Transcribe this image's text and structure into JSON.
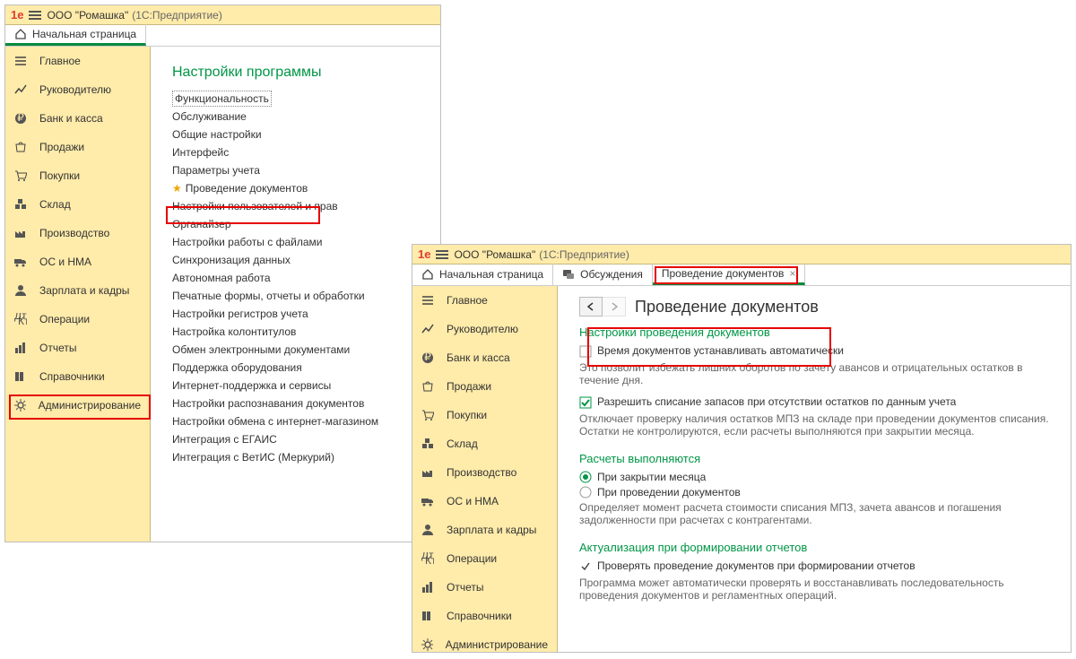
{
  "win1": {
    "title_org": "ООО \"Ромашка\"",
    "title_app": "(1С:Предприятие)",
    "tab_home": "Начальная страница",
    "sidebar": {
      "items": [
        {
          "label": "Главное"
        },
        {
          "label": "Руководителю"
        },
        {
          "label": "Банк и касса"
        },
        {
          "label": "Продажи"
        },
        {
          "label": "Покупки"
        },
        {
          "label": "Склад"
        },
        {
          "label": "Производство"
        },
        {
          "label": "ОС и НМА"
        },
        {
          "label": "Зарплата и кадры"
        },
        {
          "label": "Операции"
        },
        {
          "label": "Отчеты"
        },
        {
          "label": "Справочники"
        },
        {
          "label": "Администрирование"
        }
      ]
    },
    "content": {
      "heading": "Настройки программы",
      "links": [
        "Функциональность",
        "Обслуживание",
        "Общие настройки",
        "Интерфейс",
        "Параметры учета",
        "Проведение документов",
        "Настройки пользователей и прав",
        "Органайзер",
        "Настройки работы с файлами",
        "Синхронизация данных",
        "Автономная работа",
        "Печатные формы, отчеты и обработки",
        "Настройки регистров учета",
        "Настройка колонтитулов",
        "Обмен электронными документами",
        "Поддержка оборудования",
        "Интернет-поддержка и сервисы",
        "Настройки распознавания документов",
        "Настройки обмена с интернет-магазином",
        "Интеграция с ЕГАИС",
        "Интеграция с ВетИС (Меркурий)"
      ]
    }
  },
  "win2": {
    "title_org": "ООО \"Ромашка\"",
    "title_app": "(1С:Предприятие)",
    "tabs": {
      "home": "Начальная страница",
      "discuss": "Обсуждения",
      "docposting": "Проведение документов"
    },
    "sidebar": {
      "items": [
        {
          "label": "Главное"
        },
        {
          "label": "Руководителю"
        },
        {
          "label": "Банк и касса"
        },
        {
          "label": "Продажи"
        },
        {
          "label": "Покупки"
        },
        {
          "label": "Склад"
        },
        {
          "label": "Производство"
        },
        {
          "label": "ОС и НМА"
        },
        {
          "label": "Зарплата и кадры"
        },
        {
          "label": "Операции"
        },
        {
          "label": "Отчеты"
        },
        {
          "label": "Справочники"
        },
        {
          "label": "Администрирование"
        }
      ]
    },
    "page": {
      "title": "Проведение документов",
      "section1_heading": "Настройки проведения документов",
      "opt1_label": "Время документов устанавливать автоматически",
      "opt1_help": "Это позволит избежать лишних оборотов по зачету авансов и отрицательных остатков в течение дня.",
      "opt2_label": "Разрешить списание запасов при отсутствии остатков по данным учета",
      "opt2_help": "Отключает проверку наличия остатков МПЗ на складе при проведении документов списания. Остатки не контролируются, если расчеты выполняются при закрытии месяца.",
      "section2_heading": "Расчеты выполняются",
      "radio1": "При закрытии месяца",
      "radio2": "При проведении документов",
      "section2_help": "Определяет момент расчета стоимости списания МПЗ, зачета авансов и погашения задолженности при расчетах с контрагентами.",
      "section3_heading": "Актуализация при формировании отчетов",
      "chk3_label": "Проверять проведение документов при формировании отчетов",
      "section3_help": "Программа может автоматически проверять и восстанавливать последовательность проведения документов и регламентных операций."
    }
  }
}
